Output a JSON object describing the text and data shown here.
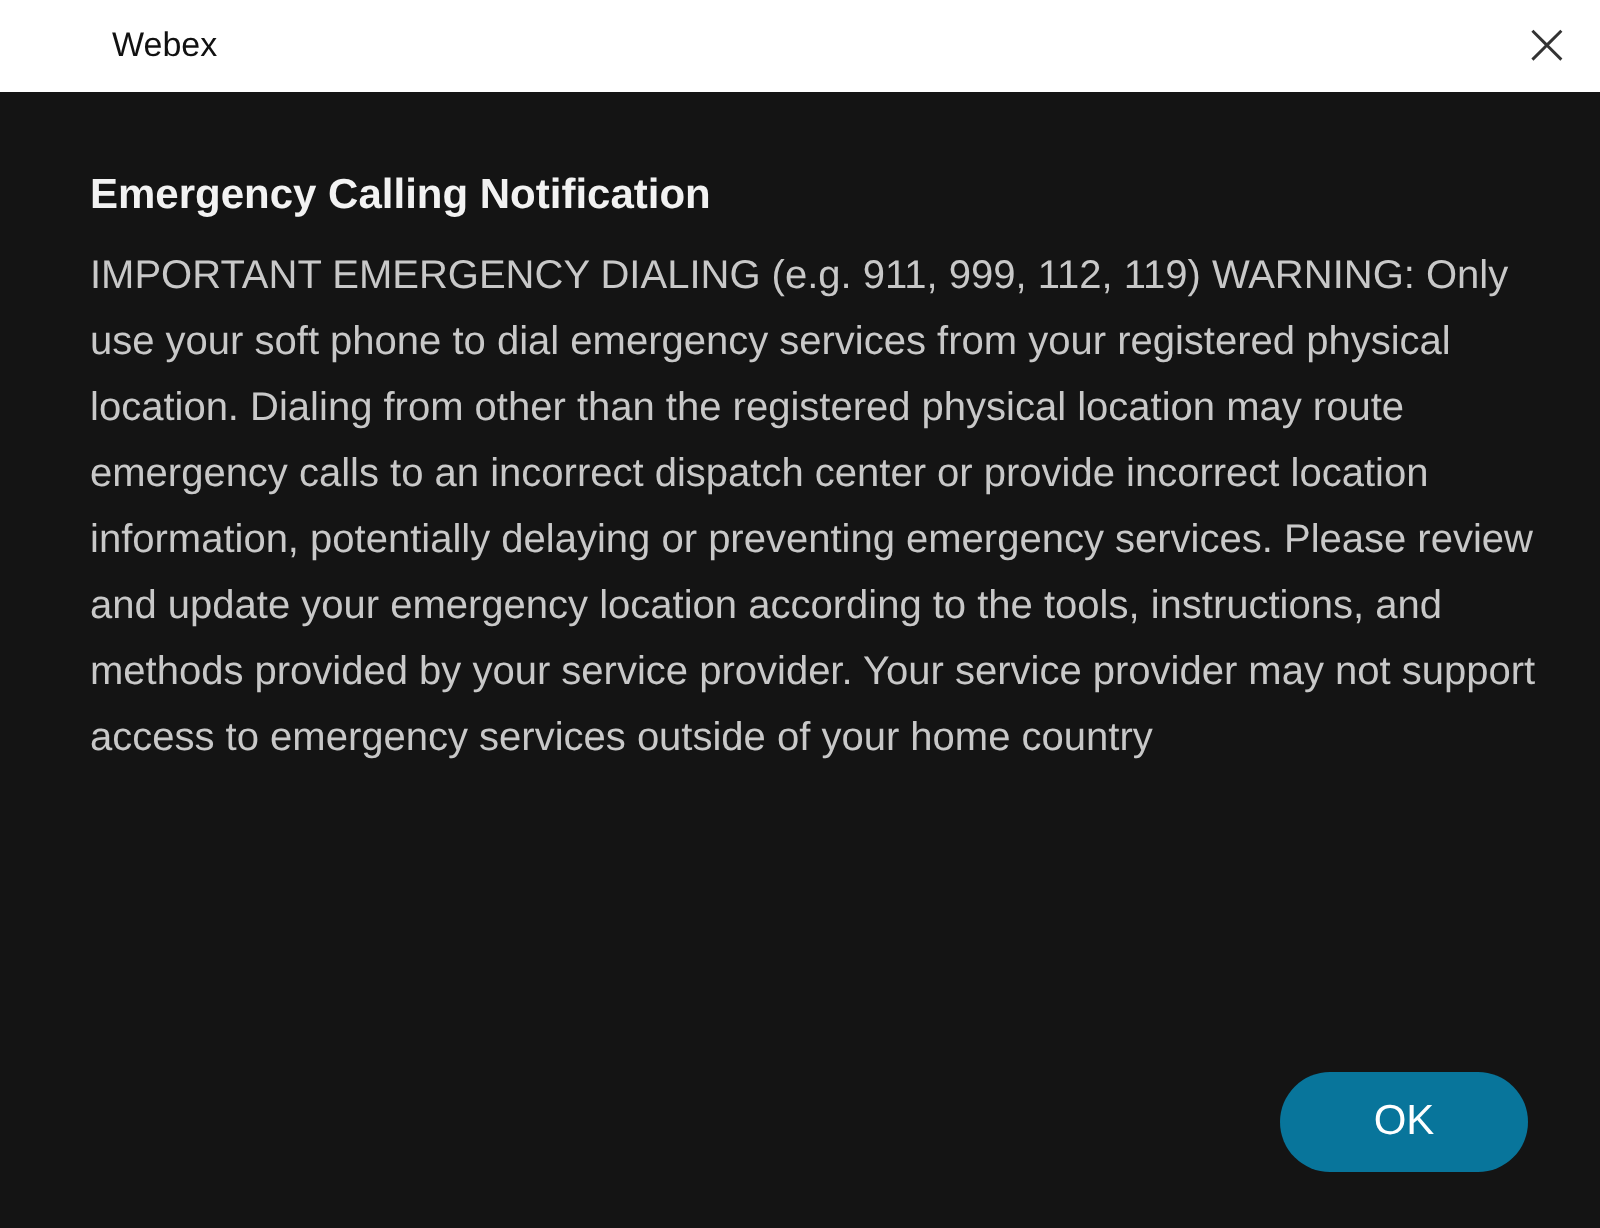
{
  "window": {
    "title": "Webex",
    "close": "×"
  },
  "dialog": {
    "heading": "Emergency Calling Notification",
    "message": "IMPORTANT EMERGENCY DIALING (e.g. 911, 999, 112, 119) WARNING: Only use your soft phone to dial emergency services from your registered physical location. Dialing from other than the registered physical location may route emergency calls to an incorrect dispatch center or provide incorrect location information, potentially delaying or preventing emergency services. Please review and update your emergency location according to the tools, instructions, and methods provided by your service provider. Your service provider may not support access to emergency services outside of your home country"
  },
  "buttons": [
    "OK"
  ]
}
